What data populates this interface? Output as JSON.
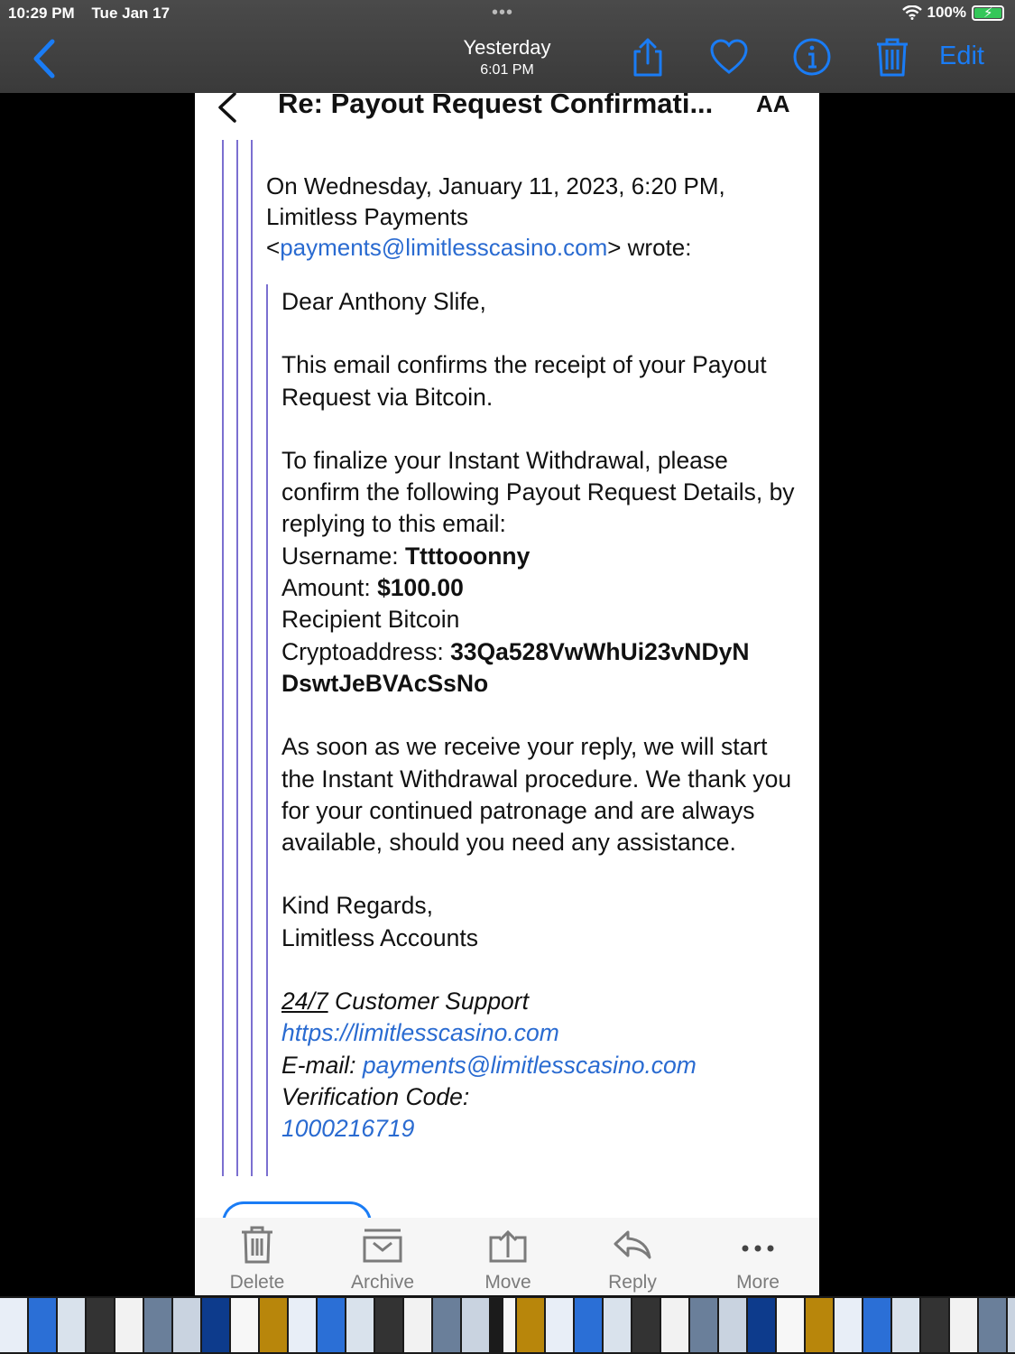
{
  "status_bar": {
    "time": "10:29 PM",
    "date": "Tue Jan 17",
    "dots": "•••",
    "battery": "100%"
  },
  "viewer": {
    "title": "Yesterday",
    "subtitle": "6:01 PM",
    "edit_label": "Edit"
  },
  "mail": {
    "subject": "Re: Payout Request Confirmati...",
    "aa_label": "AA",
    "intro_line1": "On Wednesday, January 11, 2023, 6:20 PM,",
    "intro_line2": "Limitless Payments",
    "intro_lt": "<",
    "intro_email": "payments@limitlesscasino.com",
    "intro_gt": "> wrote:",
    "greeting": "Dear Anthony Slife,",
    "para1": "This email confirms the receipt of your Payout Request via Bitcoin.",
    "para2": "To finalize your Instant Withdrawal, please confirm the following Payout Request Details, by replying to this email:",
    "username_label": "Username: ",
    "username_value": "Ttttooonny",
    "amount_label": "Amount: ",
    "amount_value": "$100.00",
    "recipient_label": "Recipient Bitcoin",
    "crypto_label": "Cryptoaddress: ",
    "crypto_value_1": "33Qa528VwWhUi23vNDyN",
    "crypto_value_2": "DswtJeBVAcSsNo",
    "para3": "As soon as we receive your reply, we will start the Instant Withdrawal procedure. We thank you for your continued patronage and are always available, should you need any assistance.",
    "closing": "Kind Regards,",
    "closing_name": "Limitless Accounts",
    "support_247": "24/7",
    "support_label": " Customer Support",
    "website": "https://limitlesscasino.com",
    "email_label": "E-mail: ",
    "email_value": "payments@limitlesscasino.com",
    "verification_label": "Verification Code:",
    "verification_code": "1000216719"
  },
  "toolbar": {
    "delete": "Delete",
    "archive": "Archive",
    "move": "Move",
    "reply": "Reply",
    "more": "More"
  },
  "colors": {
    "accent": "#1a7cf5",
    "link": "#2a6bd1",
    "quote_line": "#7b6fd0",
    "battery": "#34c759"
  }
}
